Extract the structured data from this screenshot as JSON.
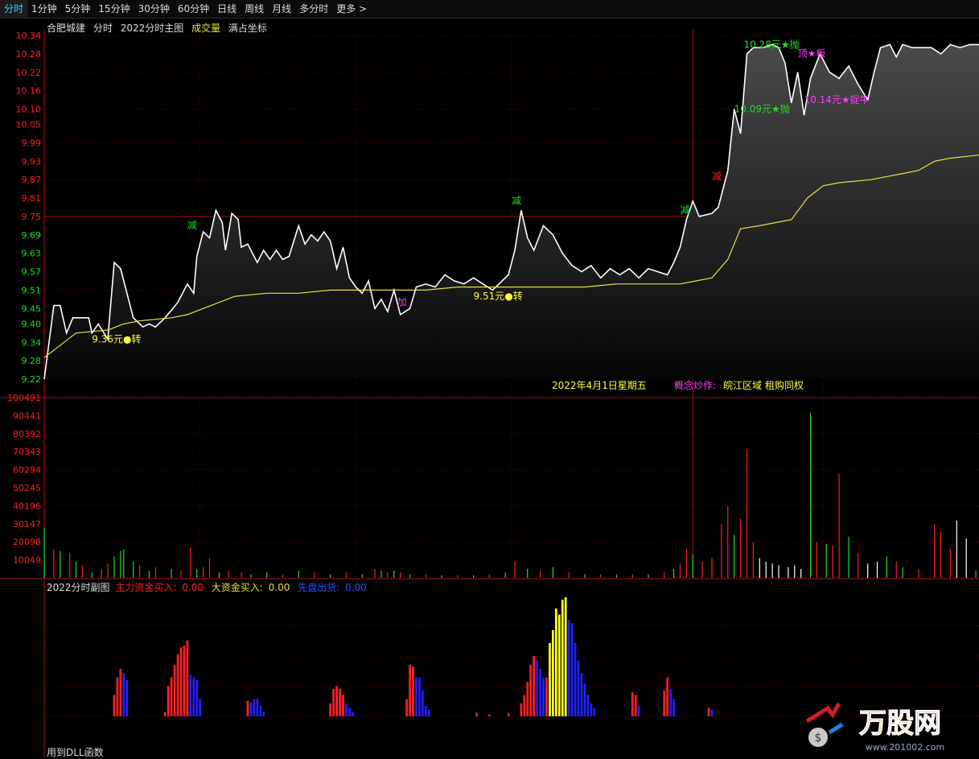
{
  "tabs": [
    {
      "label": "分时",
      "active": true
    },
    {
      "label": "1分钟"
    },
    {
      "label": "5分钟"
    },
    {
      "label": "15分钟"
    },
    {
      "label": "30分钟"
    },
    {
      "label": "60分钟"
    },
    {
      "label": "日线"
    },
    {
      "label": "周线"
    },
    {
      "label": "月线"
    },
    {
      "label": "多分时"
    },
    {
      "label": "更多"
    }
  ],
  "main_header": {
    "stock": "合肥城建",
    "mode": "分时",
    "indicator": "2022分时主图",
    "vol_label": "成交量",
    "coord": "满占坐标"
  },
  "sub_header": {
    "name": "2022分时副图",
    "s1": "主力资金买入:",
    "s1v": "0.00",
    "s2": "大资金买入:",
    "s2v": "0.00",
    "s3": "先盘出货:",
    "s3v": "0.00"
  },
  "footer": "用到DLL函数",
  "date_text": "2022年4月1日星期五",
  "concept_label": "概念炒作:",
  "concept_value": "皖江区域 租购同权",
  "logo_text": "万股网",
  "logo_url": "www.201002.com",
  "colors": {
    "up": "#ff2020",
    "down": "#20e020",
    "price": "#ffffff",
    "avg": "#e8e23c",
    "grid": "#5a0000",
    "axis": "#b01010",
    "magenta": "#ff40ff",
    "yellow": "#ffff40",
    "blue": "#2020ff"
  },
  "chart_data": {
    "type": "line",
    "price_axis": {
      "ticks": [
        10.34,
        10.28,
        10.22,
        10.16,
        10.1,
        10.05,
        9.99,
        9.93,
        9.87,
        9.81,
        9.75,
        9.69,
        9.63,
        9.57,
        9.51,
        9.45,
        9.4,
        9.34,
        9.28,
        9.22
      ],
      "ylim": [
        9.22,
        10.34
      ],
      "ref": 9.75
    },
    "volume_axis": {
      "ticks": [
        100491,
        90441,
        80392,
        70343,
        60294,
        50245,
        40196,
        30147,
        20098,
        10049
      ],
      "ylim": [
        0,
        100491
      ]
    },
    "price": [
      [
        0,
        9.22
      ],
      [
        3,
        9.46
      ],
      [
        5,
        9.46
      ],
      [
        7,
        9.37
      ],
      [
        9,
        9.42
      ],
      [
        14,
        9.42
      ],
      [
        15,
        9.37
      ],
      [
        17,
        9.4
      ],
      [
        20,
        9.35
      ],
      [
        22,
        9.6
      ],
      [
        24,
        9.58
      ],
      [
        28,
        9.42
      ],
      [
        31,
        9.39
      ],
      [
        33,
        9.4
      ],
      [
        35,
        9.39
      ],
      [
        38,
        9.42
      ],
      [
        42,
        9.47
      ],
      [
        45,
        9.53
      ],
      [
        47,
        9.5
      ],
      [
        48,
        9.62
      ],
      [
        50,
        9.7
      ],
      [
        52,
        9.68
      ],
      [
        54,
        9.77
      ],
      [
        56,
        9.73
      ],
      [
        57,
        9.64
      ],
      [
        59,
        9.76
      ],
      [
        61,
        9.74
      ],
      [
        62,
        9.65
      ],
      [
        64,
        9.66
      ],
      [
        67,
        9.6
      ],
      [
        69,
        9.64
      ],
      [
        71,
        9.61
      ],
      [
        73,
        9.64
      ],
      [
        75,
        9.61
      ],
      [
        77,
        9.62
      ],
      [
        80,
        9.72
      ],
      [
        82,
        9.66
      ],
      [
        84,
        9.69
      ],
      [
        86,
        9.67
      ],
      [
        88,
        9.7
      ],
      [
        90,
        9.67
      ],
      [
        92,
        9.58
      ],
      [
        94,
        9.65
      ],
      [
        96,
        9.55
      ],
      [
        98,
        9.52
      ],
      [
        100,
        9.5
      ],
      [
        102,
        9.54
      ],
      [
        104,
        9.45
      ],
      [
        106,
        9.48
      ],
      [
        108,
        9.44
      ],
      [
        110,
        9.51
      ],
      [
        112,
        9.43
      ],
      [
        115,
        9.45
      ],
      [
        117,
        9.52
      ],
      [
        120,
        9.53
      ],
      [
        123,
        9.52
      ],
      [
        126,
        9.56
      ],
      [
        129,
        9.54
      ],
      [
        132,
        9.53
      ],
      [
        135,
        9.55
      ],
      [
        138,
        9.53
      ],
      [
        141,
        9.51
      ],
      [
        143,
        9.53
      ],
      [
        146,
        9.56
      ],
      [
        148,
        9.64
      ],
      [
        150,
        9.77
      ],
      [
        152,
        9.68
      ],
      [
        154,
        9.64
      ],
      [
        157,
        9.72
      ],
      [
        160,
        9.69
      ],
      [
        163,
        9.63
      ],
      [
        166,
        9.59
      ],
      [
        169,
        9.57
      ],
      [
        172,
        9.59
      ],
      [
        175,
        9.55
      ],
      [
        178,
        9.58
      ],
      [
        181,
        9.56
      ],
      [
        184,
        9.58
      ],
      [
        187,
        9.55
      ],
      [
        190,
        9.58
      ],
      [
        193,
        9.57
      ],
      [
        196,
        9.56
      ],
      [
        198,
        9.6
      ],
      [
        200,
        9.65
      ],
      [
        202,
        9.74
      ],
      [
        204,
        9.8
      ],
      [
        206,
        9.75
      ],
      [
        210,
        9.76
      ],
      [
        212,
        9.78
      ],
      [
        215,
        9.9
      ],
      [
        217,
        10.1
      ],
      [
        219,
        10.02
      ],
      [
        221,
        10.28
      ],
      [
        223,
        10.3
      ],
      [
        226,
        10.3
      ],
      [
        229,
        10.31
      ],
      [
        231,
        10.3
      ],
      [
        233,
        10.25
      ],
      [
        235,
        10.12
      ],
      [
        237,
        10.22
      ],
      [
        239,
        10.08
      ],
      [
        241,
        10.2
      ],
      [
        244,
        10.28
      ],
      [
        247,
        10.22
      ],
      [
        250,
        10.2
      ],
      [
        253,
        10.24
      ],
      [
        256,
        10.18
      ],
      [
        259,
        10.13
      ],
      [
        261,
        10.22
      ],
      [
        263,
        10.3
      ],
      [
        266,
        10.31
      ],
      [
        268,
        10.27
      ],
      [
        270,
        10.31
      ],
      [
        273,
        10.3
      ],
      [
        276,
        10.3
      ],
      [
        279,
        10.3
      ],
      [
        282,
        10.28
      ],
      [
        285,
        10.31
      ],
      [
        288,
        10.3
      ],
      [
        291,
        10.31
      ],
      [
        294,
        10.31
      ]
    ],
    "avg": [
      [
        0,
        9.29
      ],
      [
        10,
        9.37
      ],
      [
        20,
        9.38
      ],
      [
        25,
        9.4
      ],
      [
        30,
        9.41
      ],
      [
        40,
        9.42
      ],
      [
        45,
        9.43
      ],
      [
        50,
        9.45
      ],
      [
        55,
        9.47
      ],
      [
        60,
        9.49
      ],
      [
        70,
        9.5
      ],
      [
        80,
        9.5
      ],
      [
        90,
        9.51
      ],
      [
        100,
        9.51
      ],
      [
        110,
        9.51
      ],
      [
        120,
        9.51
      ],
      [
        130,
        9.52
      ],
      [
        140,
        9.52
      ],
      [
        150,
        9.52
      ],
      [
        160,
        9.52
      ],
      [
        170,
        9.52
      ],
      [
        180,
        9.53
      ],
      [
        190,
        9.53
      ],
      [
        200,
        9.53
      ],
      [
        205,
        9.54
      ],
      [
        210,
        9.55
      ],
      [
        215,
        9.61
      ],
      [
        219,
        9.71
      ],
      [
        225,
        9.72
      ],
      [
        230,
        9.73
      ],
      [
        235,
        9.74
      ],
      [
        240,
        9.81
      ],
      [
        245,
        9.85
      ],
      [
        250,
        9.86
      ],
      [
        260,
        9.87
      ],
      [
        270,
        9.89
      ],
      [
        275,
        9.9
      ],
      [
        280,
        9.93
      ],
      [
        285,
        9.94
      ],
      [
        294,
        9.95
      ]
    ],
    "signals": [
      {
        "t": 16,
        "p": 9.34,
        "text": "9.36元●转",
        "color": "yellow"
      },
      {
        "t": 46,
        "p": 9.71,
        "text": "减",
        "color": "green"
      },
      {
        "t": 112,
        "p": 9.46,
        "text": "加",
        "color": "magenta"
      },
      {
        "t": 136,
        "p": 9.48,
        "text": "9.51元●转",
        "color": "yellow"
      },
      {
        "t": 148,
        "p": 9.79,
        "text": "减",
        "color": "green"
      },
      {
        "t": 201,
        "p": 9.76,
        "text": "减",
        "color": "green"
      },
      {
        "t": 211,
        "p": 9.87,
        "text": "减",
        "color": "red"
      },
      {
        "t": 218,
        "p": 10.09,
        "text": "10.09元★抛",
        "color": "green"
      },
      {
        "t": 221,
        "p": 10.3,
        "text": "10.28元★抛",
        "color": "green"
      },
      {
        "t": 238,
        "p": 10.27,
        "text": "顶★板",
        "color": "magenta"
      },
      {
        "t": 240,
        "p": 10.12,
        "text": "10.14元★捉牛",
        "color": "magenta"
      }
    ],
    "volume": [
      [
        0,
        28000,
        "g"
      ],
      [
        3,
        16000,
        "r"
      ],
      [
        5,
        15000,
        "g"
      ],
      [
        8,
        14000,
        "r"
      ],
      [
        10,
        9000,
        "g"
      ],
      [
        12,
        7000,
        "r"
      ],
      [
        15,
        3000,
        "g"
      ],
      [
        18,
        5000,
        "r"
      ],
      [
        20,
        8000,
        "r"
      ],
      [
        22,
        12000,
        "g"
      ],
      [
        24,
        15000,
        "g"
      ],
      [
        25,
        16000,
        "g"
      ],
      [
        28,
        9000,
        "g"
      ],
      [
        30,
        7000,
        "r"
      ],
      [
        33,
        4000,
        "g"
      ],
      [
        35,
        6000,
        "r"
      ],
      [
        40,
        5000,
        "g"
      ],
      [
        43,
        4000,
        "r"
      ],
      [
        46,
        17000,
        "r"
      ],
      [
        48,
        5000,
        "g"
      ],
      [
        50,
        6000,
        "r"
      ],
      [
        52,
        11000,
        "r"
      ],
      [
        55,
        3000,
        "g"
      ],
      [
        58,
        4000,
        "r"
      ],
      [
        62,
        3000,
        "r"
      ],
      [
        65,
        2000,
        "g"
      ],
      [
        70,
        3000,
        "g"
      ],
      [
        75,
        2000,
        "r"
      ],
      [
        80,
        4000,
        "g"
      ],
      [
        85,
        3000,
        "r"
      ],
      [
        90,
        2000,
        "g"
      ],
      [
        95,
        3000,
        "r"
      ],
      [
        100,
        2000,
        "g"
      ],
      [
        104,
        5000,
        "r"
      ],
      [
        106,
        4000,
        "g"
      ],
      [
        108,
        3000,
        "r"
      ],
      [
        110,
        4000,
        "g"
      ],
      [
        112,
        3000,
        "r"
      ],
      [
        115,
        2000,
        "g"
      ],
      [
        120,
        2000,
        "r"
      ],
      [
        125,
        1500,
        "g"
      ],
      [
        130,
        1500,
        "r"
      ],
      [
        135,
        1500,
        "g"
      ],
      [
        140,
        2000,
        "r"
      ],
      [
        145,
        3000,
        "g"
      ],
      [
        148,
        9000,
        "r"
      ],
      [
        152,
        5000,
        "g"
      ],
      [
        156,
        4000,
        "r"
      ],
      [
        160,
        6000,
        "g"
      ],
      [
        165,
        3000,
        "r"
      ],
      [
        170,
        2000,
        "g"
      ],
      [
        175,
        2000,
        "r"
      ],
      [
        180,
        2000,
        "g"
      ],
      [
        185,
        2000,
        "r"
      ],
      [
        190,
        2000,
        "g"
      ],
      [
        195,
        3000,
        "r"
      ],
      [
        198,
        5000,
        "g"
      ],
      [
        200,
        8000,
        "r"
      ],
      [
        202,
        16000,
        "r"
      ],
      [
        204,
        13000,
        "g"
      ],
      [
        207,
        9000,
        "r"
      ],
      [
        210,
        11000,
        "r"
      ],
      [
        213,
        30000,
        "r"
      ],
      [
        215,
        40000,
        "r"
      ],
      [
        217,
        24000,
        "g"
      ],
      [
        219,
        33000,
        "r"
      ],
      [
        221,
        72000,
        "r"
      ],
      [
        223,
        20000,
        "r"
      ],
      [
        225,
        11000,
        "w"
      ],
      [
        227,
        9000,
        "w"
      ],
      [
        229,
        8000,
        "w"
      ],
      [
        231,
        7000,
        "w"
      ],
      [
        234,
        6000,
        "w"
      ],
      [
        236,
        7000,
        "w"
      ],
      [
        238,
        5000,
        "w"
      ],
      [
        241,
        92000,
        "g"
      ],
      [
        243,
        20000,
        "r"
      ],
      [
        246,
        19000,
        "g"
      ],
      [
        248,
        18000,
        "r"
      ],
      [
        250,
        58000,
        "r"
      ],
      [
        253,
        23000,
        "g"
      ],
      [
        256,
        14000,
        "r"
      ],
      [
        259,
        8000,
        "w"
      ],
      [
        262,
        9000,
        "w"
      ],
      [
        265,
        12000,
        "g"
      ],
      [
        268,
        9000,
        "r"
      ],
      [
        270,
        6000,
        "g"
      ],
      [
        275,
        5000,
        "r"
      ],
      [
        280,
        30000,
        "r"
      ],
      [
        282,
        26000,
        "r"
      ],
      [
        285,
        16000,
        "r"
      ],
      [
        287,
        32000,
        "w"
      ],
      [
        290,
        22000,
        "w"
      ],
      [
        293,
        4000,
        "g"
      ]
    ],
    "sub_bars": [
      [
        22,
        0.25,
        "r"
      ],
      [
        23,
        0.45,
        "r"
      ],
      [
        24,
        0.55,
        "r"
      ],
      [
        25,
        0.5,
        "b"
      ],
      [
        26,
        0.42,
        "b"
      ],
      [
        38,
        0.05,
        "r"
      ],
      [
        39,
        0.35,
        "r"
      ],
      [
        40,
        0.45,
        "r"
      ],
      [
        41,
        0.6,
        "r"
      ],
      [
        42,
        0.72,
        "r"
      ],
      [
        43,
        0.8,
        "r"
      ],
      [
        44,
        0.82,
        "r"
      ],
      [
        45,
        0.88,
        "r"
      ],
      [
        46,
        0.48,
        "b"
      ],
      [
        47,
        0.45,
        "b"
      ],
      [
        48,
        0.42,
        "b"
      ],
      [
        49,
        0.2,
        "b"
      ],
      [
        64,
        0.18,
        "r"
      ],
      [
        65,
        0.16,
        "b"
      ],
      [
        66,
        0.2,
        "b"
      ],
      [
        67,
        0.2,
        "b"
      ],
      [
        68,
        0.12,
        "b"
      ],
      [
        69,
        0.05,
        "b"
      ],
      [
        90,
        0.15,
        "r"
      ],
      [
        91,
        0.32,
        "r"
      ],
      [
        92,
        0.35,
        "r"
      ],
      [
        93,
        0.32,
        "r"
      ],
      [
        94,
        0.25,
        "r"
      ],
      [
        95,
        0.15,
        "b"
      ],
      [
        96,
        0.1,
        "b"
      ],
      [
        97,
        0.05,
        "b"
      ],
      [
        114,
        0.2,
        "r"
      ],
      [
        115,
        0.6,
        "r"
      ],
      [
        116,
        0.58,
        "r"
      ],
      [
        117,
        0.45,
        "b"
      ],
      [
        118,
        0.45,
        "b"
      ],
      [
        119,
        0.3,
        "b"
      ],
      [
        120,
        0.12,
        "b"
      ],
      [
        121,
        0.08,
        "b"
      ],
      [
        136,
        0.04,
        "r"
      ],
      [
        140,
        0.02,
        "r"
      ],
      [
        146,
        0.04,
        "r"
      ],
      [
        150,
        0.15,
        "r"
      ],
      [
        151,
        0.25,
        "r"
      ],
      [
        152,
        0.4,
        "r"
      ],
      [
        153,
        0.6,
        "r"
      ],
      [
        154,
        0.7,
        "r"
      ],
      [
        155,
        0.65,
        "b"
      ],
      [
        156,
        0.55,
        "b"
      ],
      [
        157,
        0.45,
        "b"
      ],
      [
        158,
        0.45,
        "r"
      ],
      [
        159,
        0.85,
        "y"
      ],
      [
        160,
        1.0,
        "y"
      ],
      [
        161,
        1.25,
        "y"
      ],
      [
        162,
        1.18,
        "y"
      ],
      [
        163,
        1.35,
        "y"
      ],
      [
        164,
        1.38,
        "y"
      ],
      [
        165,
        1.12,
        "b"
      ],
      [
        166,
        1.08,
        "b"
      ],
      [
        167,
        0.85,
        "b"
      ],
      [
        168,
        0.65,
        "b"
      ],
      [
        169,
        0.5,
        "b"
      ],
      [
        170,
        0.38,
        "b"
      ],
      [
        171,
        0.25,
        "b"
      ],
      [
        172,
        0.15,
        "b"
      ],
      [
        173,
        0.1,
        "b"
      ],
      [
        185,
        0.28,
        "r"
      ],
      [
        186,
        0.25,
        "r"
      ],
      [
        187,
        0.12,
        "b"
      ],
      [
        195,
        0.3,
        "r"
      ],
      [
        196,
        0.45,
        "r"
      ],
      [
        197,
        0.32,
        "b"
      ],
      [
        198,
        0.2,
        "b"
      ],
      [
        209,
        0.1,
        "r"
      ],
      [
        210,
        0.08,
        "b"
      ]
    ]
  }
}
